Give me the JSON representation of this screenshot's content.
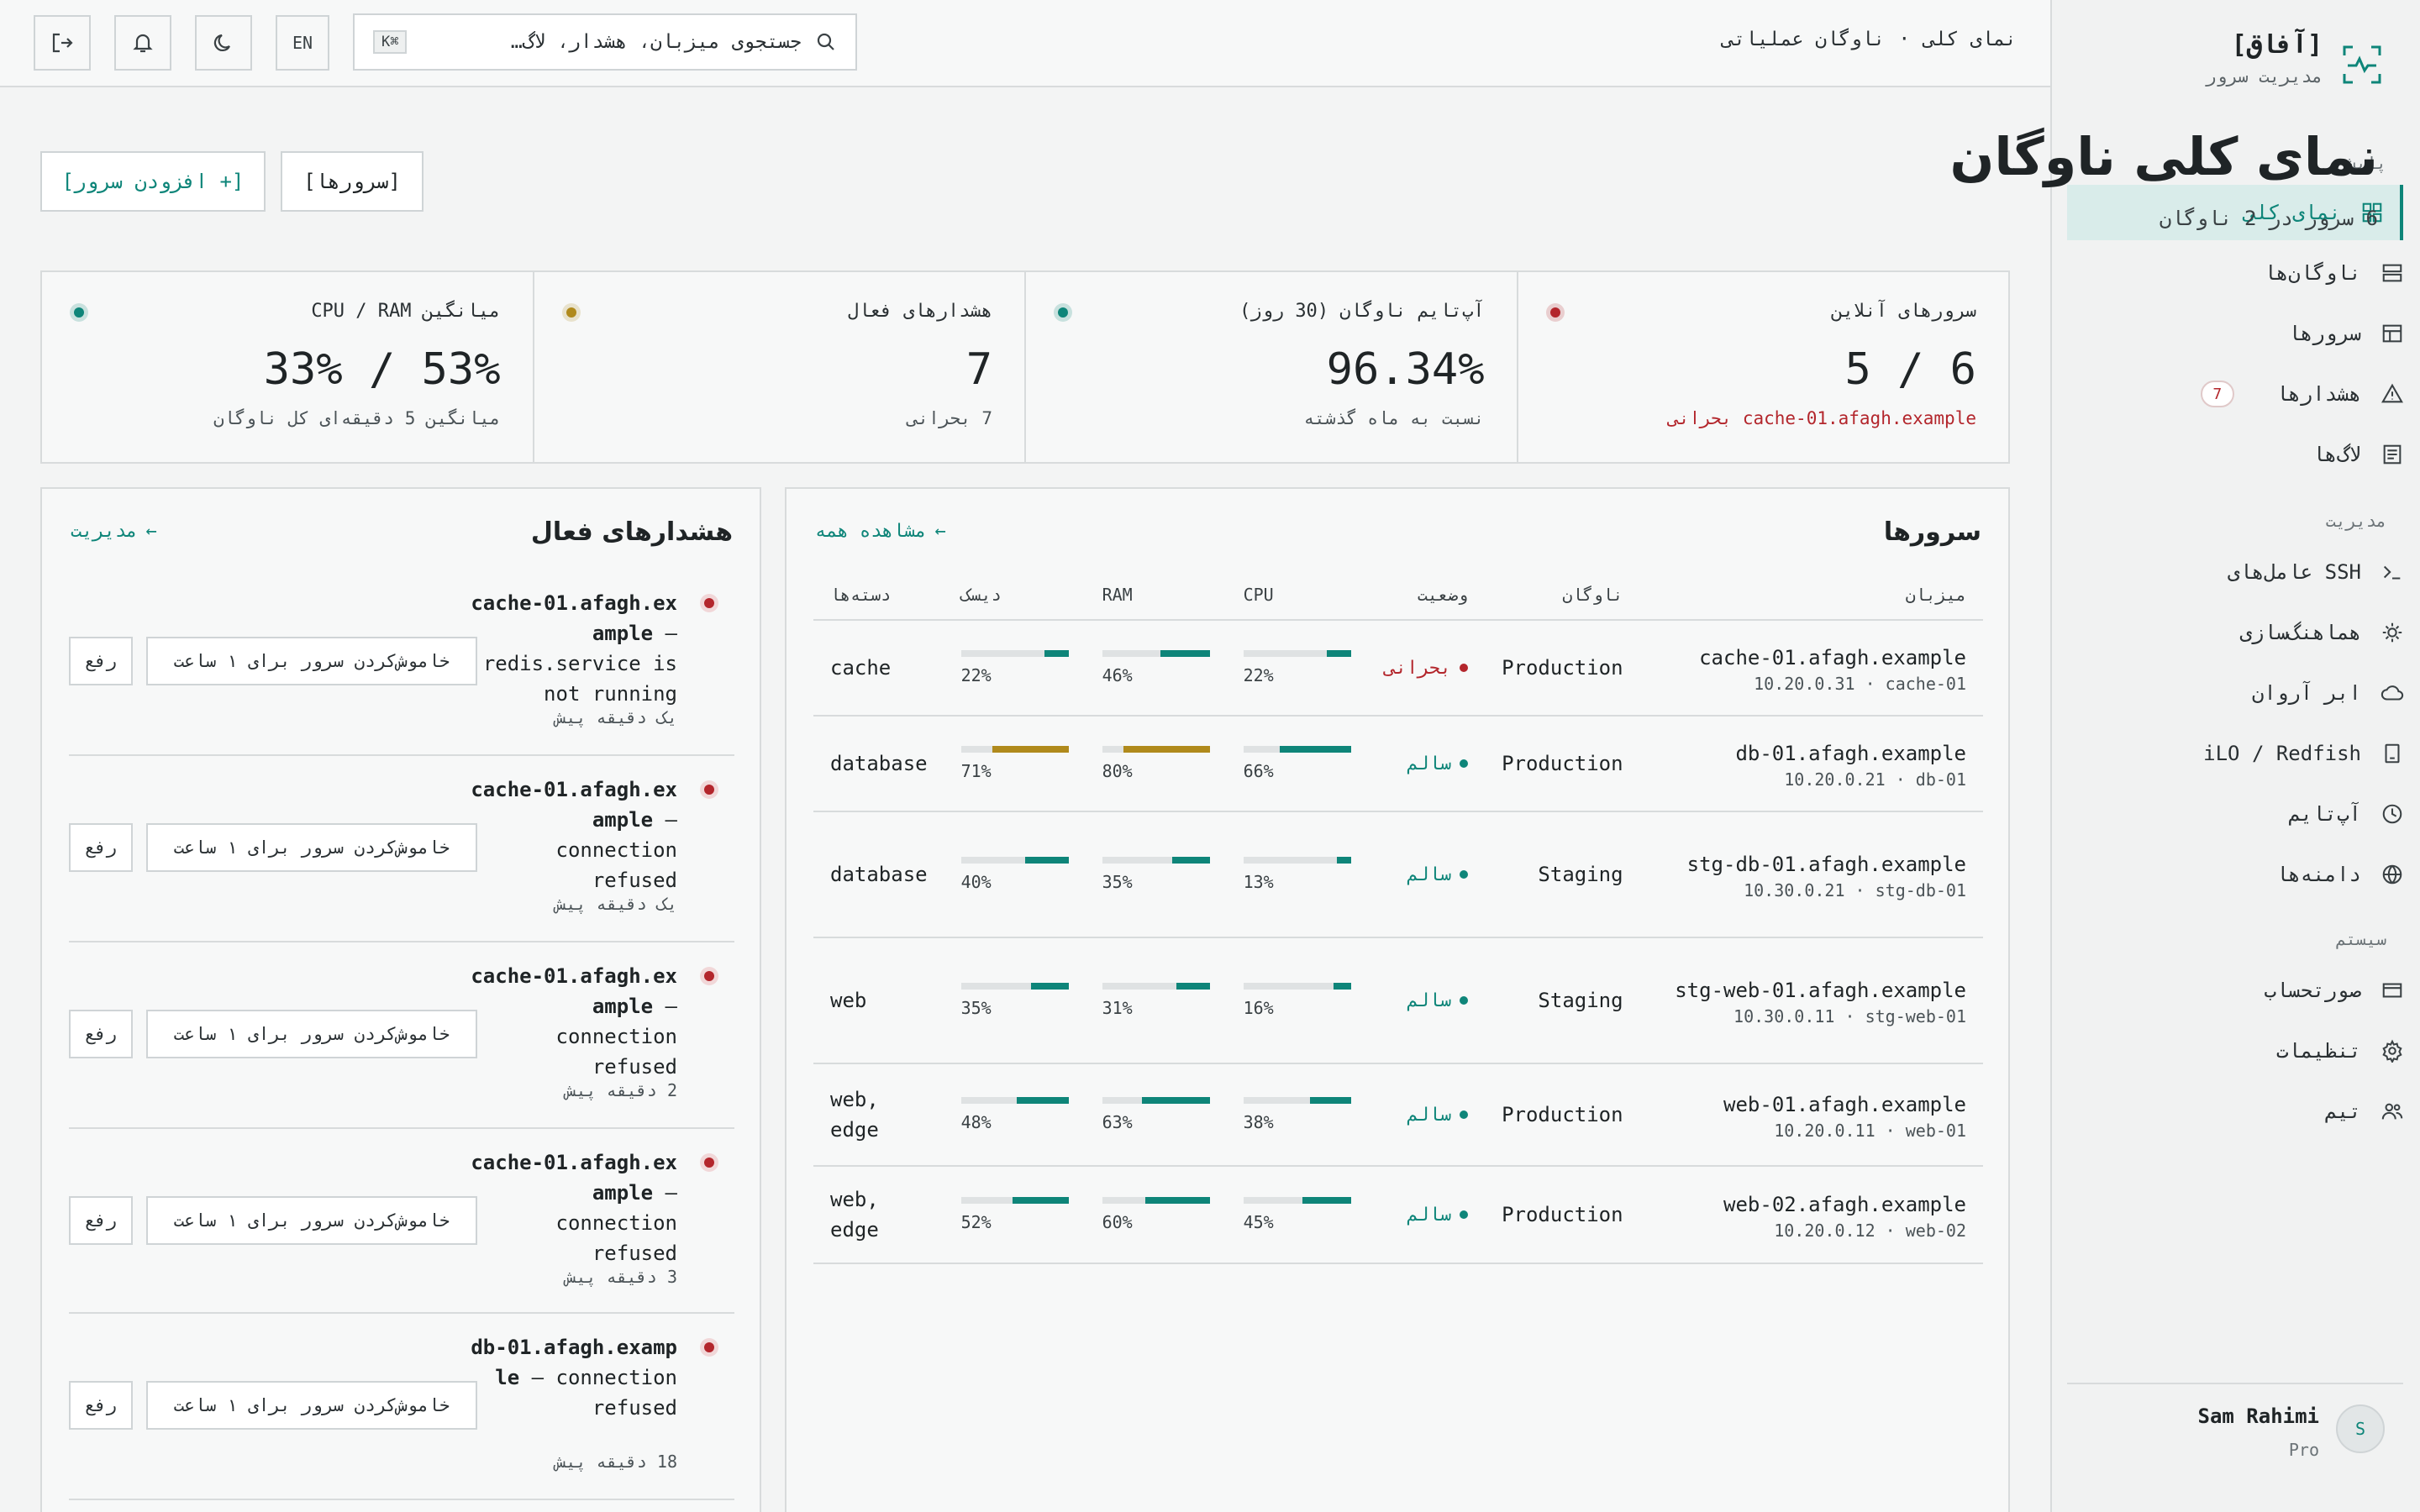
{
  "brand": {
    "name": "[آفاق]",
    "subtitle": "مدیریت سرور"
  },
  "topbar": {
    "breadcrumb": [
      "نمای کلی",
      "·",
      "ناوگان عملیاتی"
    ],
    "search_placeholder": "جستجوی میزبان، هشدار، لاگ…",
    "search_kbd": "K⌘",
    "lang_label": "EN"
  },
  "sidebar": {
    "sections": {
      "base": "پایش",
      "manage": "مدیریت",
      "system": "سیستم"
    },
    "items": [
      {
        "label": "نمای کلی",
        "icon": "grid-icon",
        "active": true
      },
      {
        "label": "ناوگان‌ها",
        "icon": "server-stack-icon"
      },
      {
        "label": "سرورها",
        "icon": "table-icon"
      },
      {
        "label": "هشدارها",
        "icon": "warning-icon",
        "badge": "7"
      },
      {
        "label": "لاگ‌ها",
        "icon": "log-icon"
      },
      {
        "label": "عامل‌های SSH",
        "icon": "terminal-icon"
      },
      {
        "label": "هماهنگ‌سازی",
        "icon": "sun-icon"
      },
      {
        "label": "ابر آروان",
        "icon": "cloud-icon"
      },
      {
        "label": "iLO / Redfish",
        "icon": "device-icon"
      },
      {
        "label": "آپ‌تایم",
        "icon": "clock-icon"
      },
      {
        "label": "دامنه‌ها",
        "icon": "globe-icon"
      },
      {
        "label": "صورتحساب",
        "icon": "card-icon"
      },
      {
        "label": "تنظیمات",
        "icon": "gear-icon"
      },
      {
        "label": "تیم",
        "icon": "users-icon"
      }
    ],
    "user": {
      "name": "Sam Rahimi",
      "plan": "Pro",
      "initial": "S"
    }
  },
  "page": {
    "title": "نمای کلی ناوگان",
    "subtitle": "6 سرور در 2 ناوگان",
    "servers_button": "[سرورها]",
    "add_button": "[+ افزودن سرور]"
  },
  "stats": [
    {
      "label": "سرورهای آنلاین",
      "value": "5 / 6",
      "note_host": "cache-01.afagh.example",
      "note_tag": "بحرانی",
      "dot": "#b3262c"
    },
    {
      "label": "آپ‌تایم ناوگان (30 روز)",
      "value": "96.34%",
      "note": "نسبت به ماه گذشته",
      "dot": "#0e8579"
    },
    {
      "label": "هشدارهای فعال",
      "value": "7",
      "note": "7 بحرانی",
      "dot": "#b08a1c"
    },
    {
      "label": "میانگین CPU / RAM",
      "value": "33% / 53%",
      "note": "میانگین 5 دقیقه‌ای کل ناوگان",
      "dot": "#0e8579"
    }
  ],
  "servers": {
    "title": "سرورها",
    "view_all": "مشاهده همه",
    "columns": [
      "میزبان",
      "ناوگان",
      "وضعیت",
      "CPU",
      "RAM",
      "دیسک",
      "دسته‌ها"
    ],
    "rows": [
      {
        "host": "cache-01.afagh.example",
        "sub": "10.20.0.31 · cache-01",
        "fleet": "Production",
        "status": "بحرانی",
        "critical": true,
        "cpu": 22,
        "ram": 46,
        "disk": 22,
        "groups": "cache"
      },
      {
        "host": "db-01.afagh.example",
        "sub": "10.20.0.21 · db-01",
        "fleet": "Production",
        "status": "سالم",
        "critical": false,
        "cpu": 66,
        "ram": 80,
        "disk": 71,
        "groups": "database"
      },
      {
        "host": "stg-db-01.afagh.example",
        "sub": "10.30.0.21 · stg-db-01",
        "fleet": "Staging",
        "status": "سالم",
        "critical": false,
        "cpu": 13,
        "ram": 35,
        "disk": 40,
        "groups": "database"
      },
      {
        "host": "stg-web-01.afagh.example",
        "sub": "10.30.0.11 · stg-web-01",
        "fleet": "Staging",
        "status": "سالم",
        "critical": false,
        "cpu": 16,
        "ram": 31,
        "disk": 35,
        "groups": "web"
      },
      {
        "host": "web-01.afagh.example",
        "sub": "10.20.0.11 · web-01",
        "fleet": "Production",
        "status": "سالم",
        "critical": false,
        "cpu": 38,
        "ram": 63,
        "disk": 48,
        "groups": "web, edge"
      },
      {
        "host": "web-02.afagh.example",
        "sub": "10.20.0.12 · web-02",
        "fleet": "Production",
        "status": "سالم",
        "critical": false,
        "cpu": 45,
        "ram": 60,
        "disk": 52,
        "groups": "web, edge"
      }
    ]
  },
  "alerts": {
    "title": "هشدارهای فعال",
    "manage": "مدیریت",
    "mute_label": "خاموش‌کردن سرور برای ۱ ساعت",
    "resolve_label": "رفع",
    "items": [
      {
        "host": "cache-01.afagh.example",
        "msg": "— redis.service is not running",
        "time": "یک دقیقه پیش"
      },
      {
        "host": "cache-01.afagh.example",
        "msg": "— connection refused",
        "time": "یک دقیقه پیش"
      },
      {
        "host": "cache-01.afagh.example",
        "msg": "— connection refused",
        "time": "2 دقیقه پیش"
      },
      {
        "host": "cache-01.afagh.example",
        "msg": "— connection refused",
        "time": "3 دقیقه پیش"
      },
      {
        "host": "db-01.afagh.example",
        "msg": "— connection refused",
        "time": "18 دقیقه پیش"
      }
    ]
  },
  "colors": {
    "accent": "#0e8579",
    "critical": "#b3262c",
    "warn": "#b08a1c"
  }
}
